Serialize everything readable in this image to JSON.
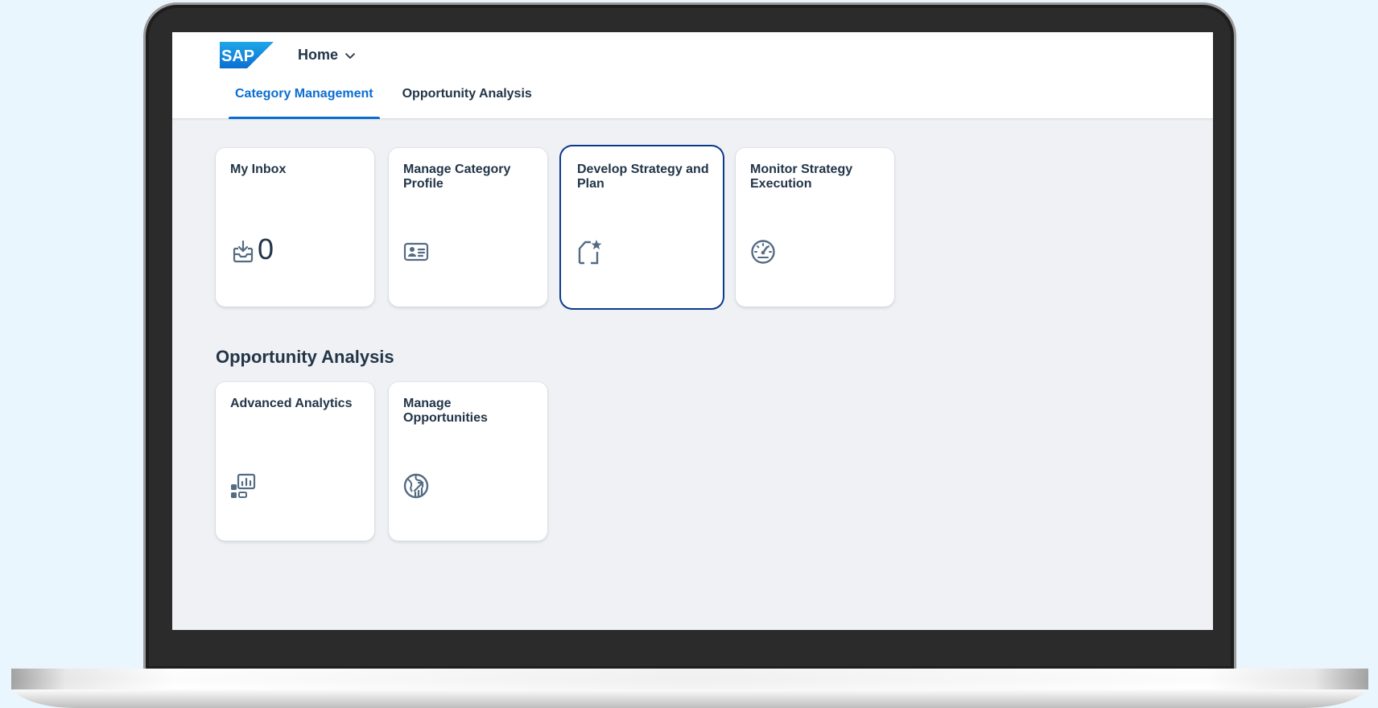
{
  "shell": {
    "logo_text": "SAP",
    "home_label": "Home",
    "brand_color": "#0a6ed1"
  },
  "tabs": [
    {
      "label": "Category Management",
      "active": true
    },
    {
      "label": "Opportunity Analysis",
      "active": false
    }
  ],
  "group1": {
    "tiles": [
      {
        "title": "My Inbox",
        "icon": "inbox-download-icon",
        "count": "0"
      },
      {
        "title": "Manage Category Profile",
        "icon": "id-card-icon"
      },
      {
        "title": "Develop Strategy and Plan",
        "icon": "document-star-icon"
      },
      {
        "title": "Monitor Strategy Execution",
        "icon": "gauge-icon"
      }
    ]
  },
  "group2": {
    "title": "Opportunity Analysis",
    "tiles": [
      {
        "title": "Advanced Analytics",
        "icon": "analytics-dashboard-icon"
      },
      {
        "title": "Manage Opportunities",
        "icon": "globe-growth-icon"
      }
    ]
  }
}
